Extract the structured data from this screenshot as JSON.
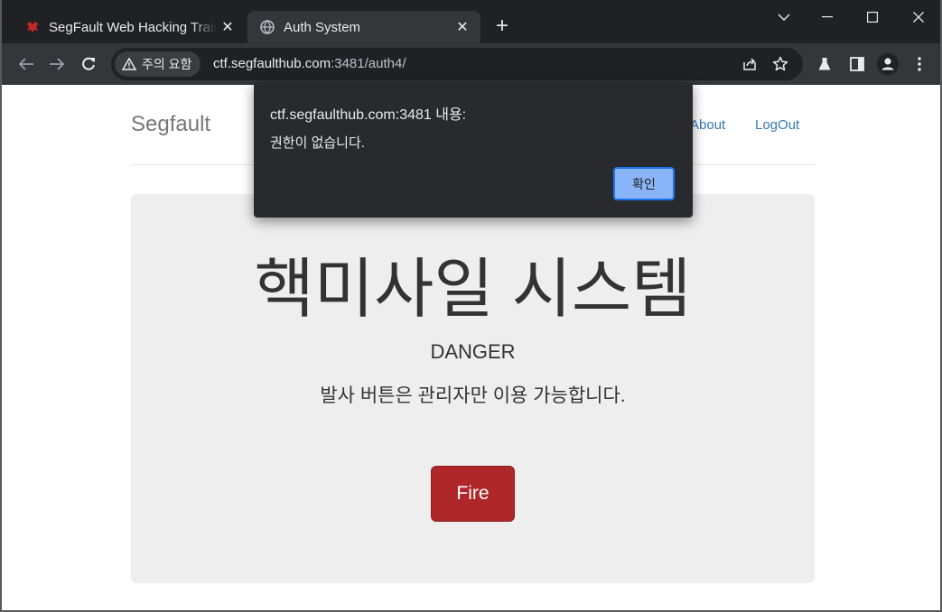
{
  "browser": {
    "tabs": [
      {
        "title": "SegFault Web Hacking Training",
        "icon": "segfault-favicon",
        "active": false
      },
      {
        "title": "Auth System",
        "icon": "globe-icon",
        "active": true
      }
    ],
    "tab_close_glyph": "✕",
    "new_tab_glyph": "+",
    "security_chip": "주의 요함",
    "url_host": "ctf.segfaulthub.com",
    "url_rest": ":3481/auth4/"
  },
  "page": {
    "brand": "Segfault",
    "nav": [
      "About",
      "LogOut"
    ],
    "heading": "핵미사일 시스템",
    "subheading": "DANGER",
    "description": "발사 버튼은 관리자만 이용 가능합니다.",
    "fire_button": "Fire",
    "fire_color": "#b0272a"
  },
  "dialog": {
    "title": "ctf.segfaulthub.com:3481 내용:",
    "message": "권한이 없습니다.",
    "ok_label": "확인",
    "accent": "#8ab4f8"
  }
}
